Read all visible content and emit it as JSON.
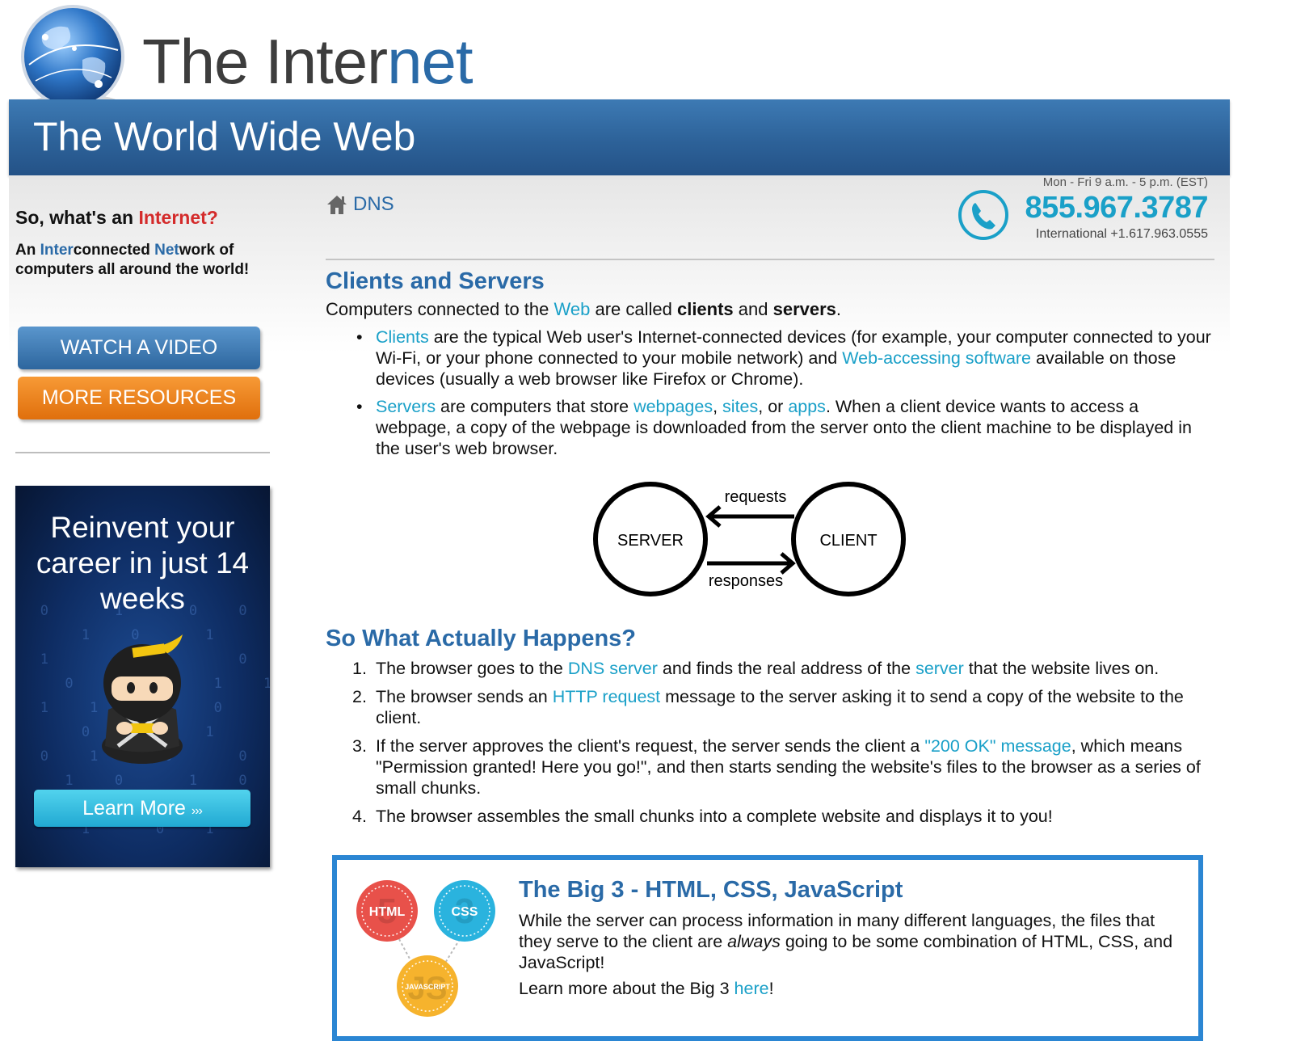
{
  "header": {
    "title_part1": "The Inter",
    "title_part2": "net",
    "banner": "The World Wide Web"
  },
  "sidebar": {
    "heading_prefix": "So, what's an ",
    "heading_highlight": "Internet?",
    "desc": {
      "an": "An ",
      "inter": "Inter",
      "connected": "connected ",
      "net": "Net",
      "rest": "work of computers all around the world!"
    },
    "watch_button": "WATCH A VIDEO",
    "resources_button": "MORE RESOURCES",
    "ad": {
      "headline": "Reinvent your career in just 14 weeks",
      "button": "Learn More",
      "button_arrows": "›››"
    }
  },
  "breadcrumb": {
    "label": "DNS"
  },
  "contact": {
    "hours": "Mon - Fri 9 a.m. - 5 p.m. (EST)",
    "phone": "855.967.3787",
    "international": "International +1.617.963.0555"
  },
  "section1": {
    "heading": "Clients and Servers",
    "intro": {
      "t1": "Computers connected to the ",
      "link_web": "Web",
      "t2": " are called ",
      "b_clients": "clients",
      "t3": " and ",
      "b_servers": "servers",
      "t4": "."
    },
    "bullet1": {
      "link_clients": "Clients",
      "t1": " are the typical Web user's Internet-connected devices (for example, your computer connected to your Wi-Fi, or your phone connected to your mobile network) and ",
      "link_software": "Web-accessing software",
      "t2": " available on those devices (usually a web browser like Firefox or Chrome)."
    },
    "bullet2": {
      "link_servers": "Servers",
      "t1": " are computers that store ",
      "link_webpages": "webpages",
      "t2": ", ",
      "link_sites": "sites",
      "t3": ", or ",
      "link_apps": "apps",
      "t4": ". When a client device wants to access a webpage, a copy of the webpage is downloaded from the server onto the client machine to be displayed in the user's web browser."
    }
  },
  "diagram": {
    "server": "SERVER",
    "client": "CLIENT",
    "requests": "requests",
    "responses": "responses"
  },
  "section2": {
    "heading": "So What Actually Happens?",
    "step1": {
      "num": "1.",
      "t1": "The browser goes to the ",
      "link_dns": "DNS server",
      "t2": " and finds the real address of the ",
      "link_server": "server",
      "t3": " that the website lives on."
    },
    "step2": {
      "num": "2.",
      "t1": "The browser sends an ",
      "link_http": "HTTP request",
      "t2": " message to the server asking it to send a copy of the website to the client."
    },
    "step3": {
      "num": "3.",
      "t1": "If the server approves the client's request, the server sends the client a ",
      "link_ok": "\"200 OK\" message",
      "t2": ", which means \"Permission granted! Here you go!\", and then starts sending the website's files to the browser as a series of small chunks."
    },
    "step4": {
      "num": "4.",
      "t1": "The browser assembles the small chunks into a complete website and displays it to you!"
    }
  },
  "big3": {
    "title": "The Big 3 - HTML, CSS, JavaScript",
    "body_t1": "While the server can process information in many different languages, the files that they serve to the client are ",
    "body_em": "always",
    "body_t2": " going to be some combination of HTML, CSS, and JavaScript!",
    "more_t1": "Learn more about the Big 3 ",
    "more_link": "here",
    "more_t2": "!",
    "badge_html": "HTML",
    "badge_css": "CSS",
    "badge_js": "JAVASCRIPT",
    "badge_html_num": "5",
    "badge_css_num": "3",
    "badge_js_num": "JS"
  },
  "colors": {
    "brand_blue": "#2a6aa7",
    "link_teal": "#1aa0c8",
    "accent_red": "#d42b2b",
    "resources_orange": "#f08a22",
    "big3_border": "#2b86d3"
  }
}
